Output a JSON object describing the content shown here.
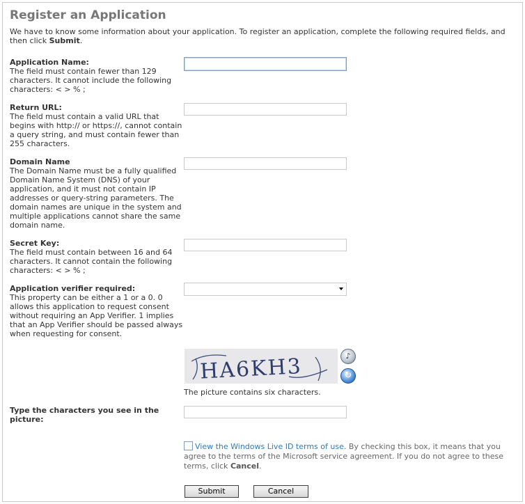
{
  "page": {
    "title": "Register an Application",
    "intro_text": "We have to know some information about your application. To register an application, complete the following required fields, and then click ",
    "intro_bold": "Submit",
    "intro_end": "."
  },
  "fields": {
    "app_name": {
      "label": "Application Name:",
      "help": "The field must contain fewer than 129 characters. It cannot include the following characters: < > % ;",
      "value": ""
    },
    "return_url": {
      "label": "Return URL:",
      "help": "The field must contain a valid URL that begins with http:// or https://, cannot contain a query string, and must contain fewer than 255 characters.",
      "value": ""
    },
    "domain_name": {
      "label": "Domain Name",
      "help": "The Domain Name must be a fully qualified Domain Name System (DNS) of your application, and it must not contain IP addresses or query-string parameters. The domain names are unique in the system and multiple applications cannot share the same domain name.",
      "value": ""
    },
    "secret_key": {
      "label": "Secret Key:",
      "help": "The field must contain between 16 and 64 characters. It cannot contain the following characters: < > % ;",
      "value": ""
    },
    "verifier": {
      "label": "Application verifier required:",
      "help": "This property can be either a 1 or a 0. 0 allows this application to request consent without requiring an App Verifier. 1 implies that an App Verifier should be passed always when requesting for consent.",
      "selected": ""
    }
  },
  "captcha": {
    "image_text": "HA6KH3",
    "note": "The picture contains six characters.",
    "label": "Type the characters you see in the picture:",
    "audio_icon": "speaker-icon",
    "refresh_icon": "refresh-icon",
    "value": ""
  },
  "terms": {
    "link_text": "View the Windows Live ID terms of use.",
    "text_before_bold": " By checking this box, it means that you agree to the terms of the Microsoft service agreement. If you do not agree to these terms, click ",
    "bold": "Cancel",
    "text_end": "."
  },
  "buttons": {
    "submit": "Submit",
    "cancel": "Cancel"
  }
}
